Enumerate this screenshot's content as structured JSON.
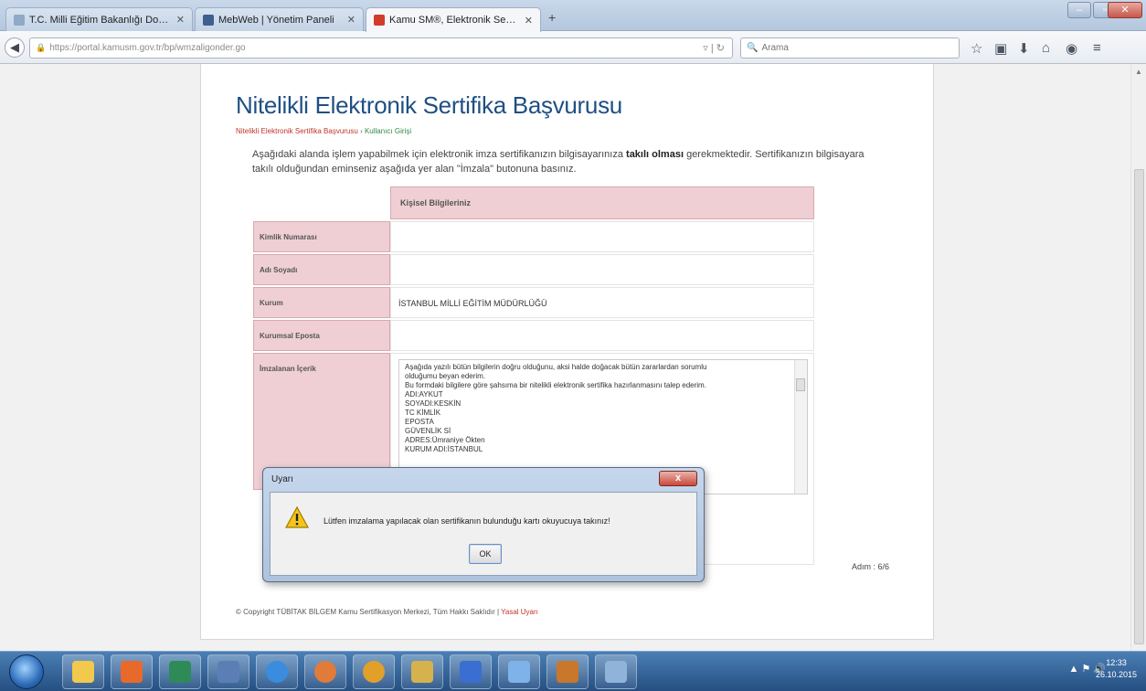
{
  "browser": {
    "tabs": [
      {
        "label": "T.C. Milli Eğitim Bakanlığı Dok...",
        "favicon_color": "#8fa9c6"
      },
      {
        "label": "MebWeb | Yönetim Paneli",
        "favicon_color": "#3f5f8e"
      },
      {
        "label": "Kamu SM®, Elektronik Sert...",
        "favicon_color": "#d23a2a"
      }
    ],
    "new_tab": "+",
    "url": "https://portal.kamusm.gov.tr/bp/wmzaligonder.go",
    "search_placeholder": "Arama"
  },
  "page": {
    "title": "Nitelikli Elektronik Sertifika Başvurusu",
    "breadcrumb": {
      "first": "Nitelikli Elektronik Sertifika Başvurusu",
      "sep": "›",
      "second": "Kullanıcı Girişi"
    },
    "intro_pre": "Aşağıdaki alanda işlem yapabilmek için elektronik imza sertifikanızın bilgisayarınıza ",
    "intro_bold": "takılı olması",
    "intro_post": " gerekmektedir. Sertifikanızın bilgisayara takılı olduğundan eminseniz aşağıda yer alan \"İmzala\" butonuna basınız.",
    "section_header": "Kişisel Bilgileriniz",
    "rows": [
      {
        "label": "Kimlik Numarası",
        "value": ""
      },
      {
        "label": "Adı Soyadı",
        "value": ""
      },
      {
        "label": "Kurum",
        "value": "İSTANBUL MİLLİ EĞİTİM MÜDÜRLÜĞÜ"
      },
      {
        "label": "Kurumsal Eposta",
        "value": ""
      },
      {
        "label": "İmzalanan İçerik",
        "value": ""
      }
    ],
    "signed_content": [
      "Aşağıda yazılı bütün bilgilerin doğru olduğunu, aksi halde doğacak bütün zararlardan sorumlu",
      "olduğumu beyan ederim.",
      "Bu formdaki bilgilere göre şahsıma bir nitelikli elektronik sertifika hazırlanmasını talep ederim.",
      "ADI:AYKUT",
      "SOYADI:KESKİN",
      "TC KİMLİK",
      "EPOSTA",
      "GÜVENLİK Sİ",
      "ADRES:Ümraniye Ökten",
      "KURUM ADI:İSTANBUL"
    ],
    "step": "Adım : 6/6",
    "footer_text": "© Copyright TÜBİTAK BİLGEM Kamu Sertifikasyon Merkezi, Tüm Hakkı Saklıdır | ",
    "footer_link": "Yasal Uyarı"
  },
  "dialog": {
    "title": "Uyarı",
    "close": "x",
    "message": "Lütfen imzalama yapılacak olan sertifikanın bulunduğu kartı okuyucuya takınız!",
    "ok": "OK"
  },
  "taskbar": {
    "items": [
      "#f2c94c",
      "#e86a2a",
      "#2e8b57",
      "#5b7fb5",
      "#3a8dde",
      "#e07b39",
      "#e0a02a",
      "#d6b24c",
      "#3a6ed0",
      "#7fb2e8",
      "#c9772b",
      "#8fb3d9"
    ],
    "clock_time": "12:33",
    "clock_date": "26.10.2015"
  }
}
